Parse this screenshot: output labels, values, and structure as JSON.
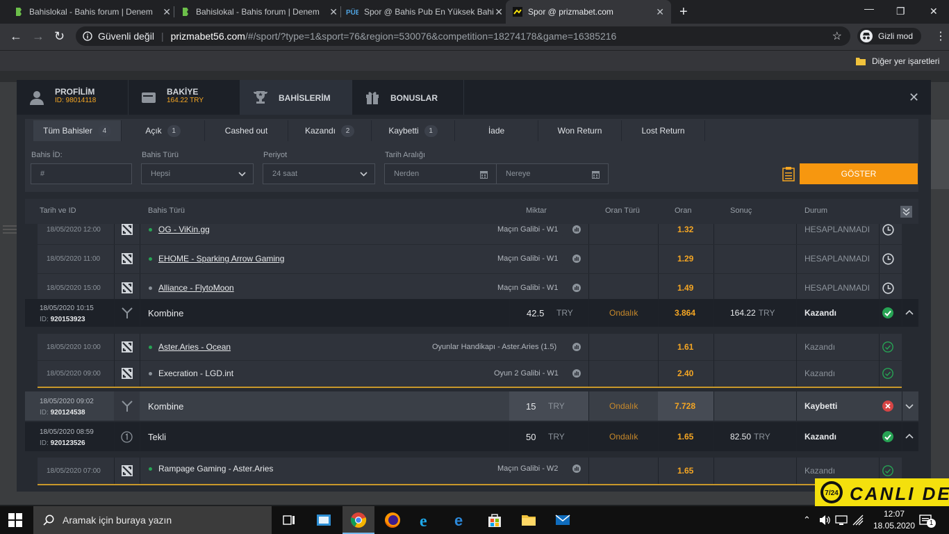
{
  "browser": {
    "tabs": [
      {
        "title": "Bahislokal - Bahis forum | Denem",
        "favicon": "bahislokal-icon"
      },
      {
        "title": "Bahislokal - Bahis forum | Denem",
        "favicon": "bahislokal-icon"
      },
      {
        "title": "Spor @ Bahis Pub En Yüksek Bahi",
        "favicon": "pub-icon"
      },
      {
        "title": "Spor @ prizmabet.com",
        "favicon": "prizmabet-icon"
      }
    ],
    "security_label": "Güvenli değil",
    "url_domain": "prizmabet56.com",
    "url_path": "/#/sport/?type=1&sport=76&region=530076&competition=18274178&game=16385216",
    "incognito_label": "Gizli mod",
    "bookmarks_label": "Diğer yer işaretleri"
  },
  "modal": {
    "tabs": [
      {
        "label": "PROFİLİM",
        "sub": "ID: 98014118",
        "icon": "user-icon"
      },
      {
        "label": "BAKİYE",
        "sub": "164.22 TRY",
        "icon": "wallet-icon"
      },
      {
        "label": "BAHİSLERİM",
        "sub": "",
        "icon": "trophy-icon"
      },
      {
        "label": "BONUSLAR",
        "sub": "",
        "icon": "gift-icon"
      }
    ],
    "close_glyph": "✕"
  },
  "filters": {
    "tabs": [
      {
        "label": "Tüm Bahisler",
        "count": "4"
      },
      {
        "label": "Açık",
        "count": "1"
      },
      {
        "label": "Cashed out",
        "count": ""
      },
      {
        "label": "Kazandı",
        "count": "2"
      },
      {
        "label": "Kaybetti",
        "count": "1"
      },
      {
        "label": "İade",
        "count": ""
      },
      {
        "label": "Won Return",
        "count": ""
      },
      {
        "label": "Lost Return",
        "count": ""
      }
    ],
    "bet_id_label": "Bahis İD:",
    "bet_id_placeholder": "#",
    "bet_type_label": "Bahis Türü",
    "bet_type_value": "Hepsi",
    "period_label": "Periyot",
    "period_value": "24 saat",
    "date_range_label": "Tarih Aralığı",
    "date_from": "Nerden",
    "date_to": "Nereye",
    "show_button": "GÖSTER"
  },
  "table": {
    "headers": {
      "date_id": "Tarih ve ID",
      "bet_type": "Bahis Türü",
      "amount": "Miktar",
      "odds_type": "Oran Türü",
      "odds": "Oran",
      "result": "Sonuç",
      "status": "Durum"
    },
    "sel_top": [
      {
        "date": "18/05/2020 12:00",
        "event": "OG - ViKin.gg",
        "market": "Maçın Galibi - W1",
        "odds": "1.32",
        "status": "HESAPLANMADI"
      },
      {
        "date": "18/05/2020 11:00",
        "event": "EHOME - Sparking Arrow Gaming",
        "market": "Maçın Galibi - W1",
        "odds": "1.29",
        "status": "HESAPLANMADI"
      },
      {
        "date": "18/05/2020 15:00",
        "event": "Alliance - FlytoMoon",
        "market": "Maçın Galibi - W1",
        "odds": "1.49",
        "status": "HESAPLANMADI"
      }
    ],
    "bet1": {
      "date": "18/05/2020 10:15",
      "id_label": "ID:",
      "id": "920153923",
      "type": "Kombine",
      "amount": "42.5",
      "currency": "TRY",
      "odds_type": "Ondalık",
      "odds": "3.864",
      "result": "164.22",
      "result_currency": "TRY",
      "status": "Kazandı"
    },
    "bet1_sels": [
      {
        "date": "18/05/2020 10:00",
        "event": "Aster.Aries - Ocean",
        "market": "Oyunlar Handikapı - Aster.Aries (1.5)",
        "odds": "1.61",
        "status": "Kazandı"
      },
      {
        "date": "18/05/2020 09:00",
        "event": "Execration - LGD.int",
        "market": "Oyun 2 Galibi - W1",
        "odds": "2.40",
        "status": "Kazandı"
      }
    ],
    "bet2": {
      "date": "18/05/2020 09:02",
      "id_label": "ID:",
      "id": "920124538",
      "type": "Kombine",
      "amount": "15",
      "currency": "TRY",
      "odds_type": "Ondalık",
      "odds": "7.728",
      "status": "Kaybetti"
    },
    "bet3": {
      "date": "18/05/2020 08:59",
      "id_label": "ID:",
      "id": "920123526",
      "type": "Tekli",
      "amount": "50",
      "currency": "TRY",
      "odds_type": "Ondalık",
      "odds": "1.65",
      "result": "82.50",
      "result_currency": "TRY",
      "status": "Kazandı"
    },
    "bet3_sels": [
      {
        "date": "18/05/2020 07:00",
        "event": "Rampage Gaming - Aster.Aries",
        "market": "Maçın Galibi - W2",
        "odds": "1.65",
        "status": "Kazandı"
      }
    ]
  },
  "taskbar": {
    "search_placeholder": "Aramak için buraya yazın",
    "time": "12:07",
    "date": "18.05.2020",
    "notif_count": "1"
  },
  "colors": {
    "accent": "#f7970f",
    "won": "#27a354",
    "lost": "#d64545",
    "odds": "#f5a623"
  }
}
